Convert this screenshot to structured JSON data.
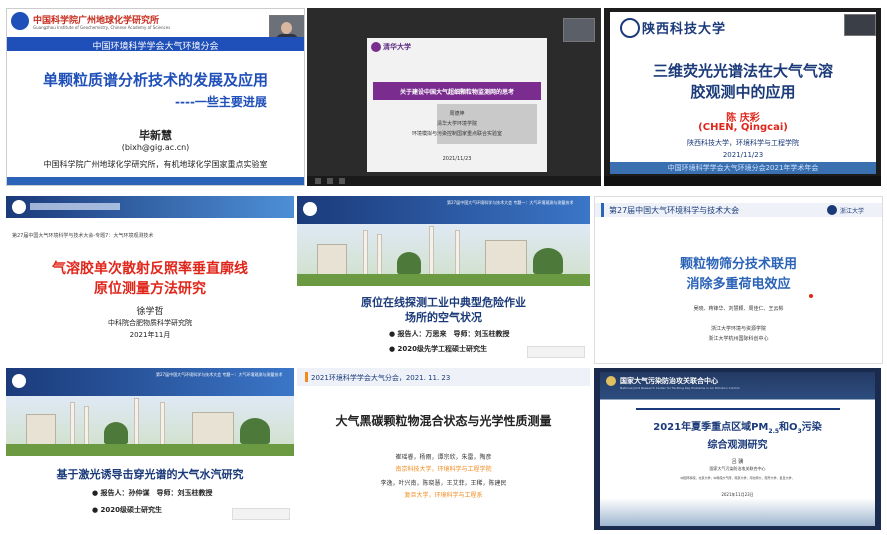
{
  "colors": {
    "blue_title": "#1f4fb8",
    "red_title": "#e0261b",
    "navy": "#1b3a7a",
    "blue_bar": "#2a63b7",
    "orange": "#f28a1e"
  },
  "tiles": [
    {
      "id": "t1",
      "logo_text": "中国科学院广州地球化学研究所",
      "logo_sub": "Guangzhou Institute of Geochemistry, Chinese Academy of Sciences",
      "banner": "中国环境科学学会大气环境分会",
      "title": "单颗粒质谱分析技术的发展及应用",
      "subtitle": "----一些主要进展",
      "author": "毕新慧",
      "email": "(bixh@gig.ac.cn)",
      "affiliation": "中国科学院广州地球化学研究所，有机地球化学国家重点实验室"
    },
    {
      "id": "t2",
      "logo_text": "清华大学",
      "title": "关于建设中国大气超细颗粒物监测网的思考",
      "author": "周德坤",
      "affil1": "清华大学环境学院",
      "affil2": "环境模拟与污染控制国家重点联合实验室",
      "date": "2021/11/23"
    },
    {
      "id": "t3",
      "logo_text": "陕西科技大学",
      "title_l1": "三维荧光光谱法在大气气溶",
      "title_l2": "胶观测中的应用",
      "author": "陈 庆彩",
      "author_en": "(CHEN, Qingcai)",
      "affiliation": "陕西科技大学，环境科学与工程学院",
      "date": "2021/11/23",
      "footer": "中国环境科学学会大气环境分会2021年学术年会"
    },
    {
      "id": "t4",
      "banner": "第27届中国大气环境科学与技术大会-专题7：大气环境观测技术",
      "title_l1": "气溶胶单次散射反照率垂直廓线",
      "title_l2": "原位测量方法研究",
      "author": "徐学哲",
      "affiliation": "中科院合肥物质科学研究院",
      "date": "2021年11月"
    },
    {
      "id": "t5",
      "header": "第27届中国大气环境科学与技术大会 专题一：大气环境观测与测量技术",
      "title_l1": "原位在线探测工业中典型危险作业",
      "title_l2": "场所的空气状况",
      "reporter": "● 报告人：万思来　导师：刘玉柱教授",
      "grade": "● 2020级先学工程硕士研究生"
    },
    {
      "id": "t6",
      "header": "第27届中国大气环境科学与技术大会",
      "logo_text": "浙江大学",
      "title_l1": "颗粒物筛分技术联用",
      "title_l2": "消除多重荷电效应",
      "authors": "吴晓、蒋锋华、刘慧颖、周佳仁、王云彬",
      "affil1": "浙江大学环境与资源学院",
      "affil2": "浙江大学杭州国际科创中心"
    },
    {
      "id": "t7",
      "header": "第27届中国大气环境科学与技术大会 专题一：大气环境观测与测量技术",
      "title": "基于激光诱导击穿光谱的大气水汽研究",
      "reporter": "● 报告人：孙仲谋　导师：刘玉柱教授",
      "grade": "● 2020级硕士研究生"
    },
    {
      "id": "t8",
      "header": "2021环境科学学会大气分会，2021. 11. 23",
      "title": "大气黑碳颗粒物混合状态与光学性质测量",
      "authors1": "崔瑶睿，杨雨，谭宗欣，朱雷，陶彦",
      "affil1": "南京科技大学，环境科学与工程学院",
      "authors2": "李逸，叶兴南，陈晓慧，王艾菲，王稀，陈建民",
      "affil2": "复旦大学，环境科学与工程系"
    },
    {
      "id": "t9",
      "org": "国家大气污染防治攻关联合中心",
      "org_en": "National Joint Research Center for Tackling Key Problems in Air Pollution Control",
      "title_l1": "2021年夏季重点区域PM",
      "pm_sub": "2.5",
      "title_mid": "和O",
      "o_sub": "3",
      "title_end": "污染",
      "title_l2": "综合观测研究",
      "author": "吕 骥",
      "affiliation": "国家大气污染防治攻关联合中心",
      "participants": "中国环科院，北京大学，中科院大气所，南京大学，河北师大，南开大学，复旦大学，",
      "date": "2021年11月23日"
    }
  ]
}
